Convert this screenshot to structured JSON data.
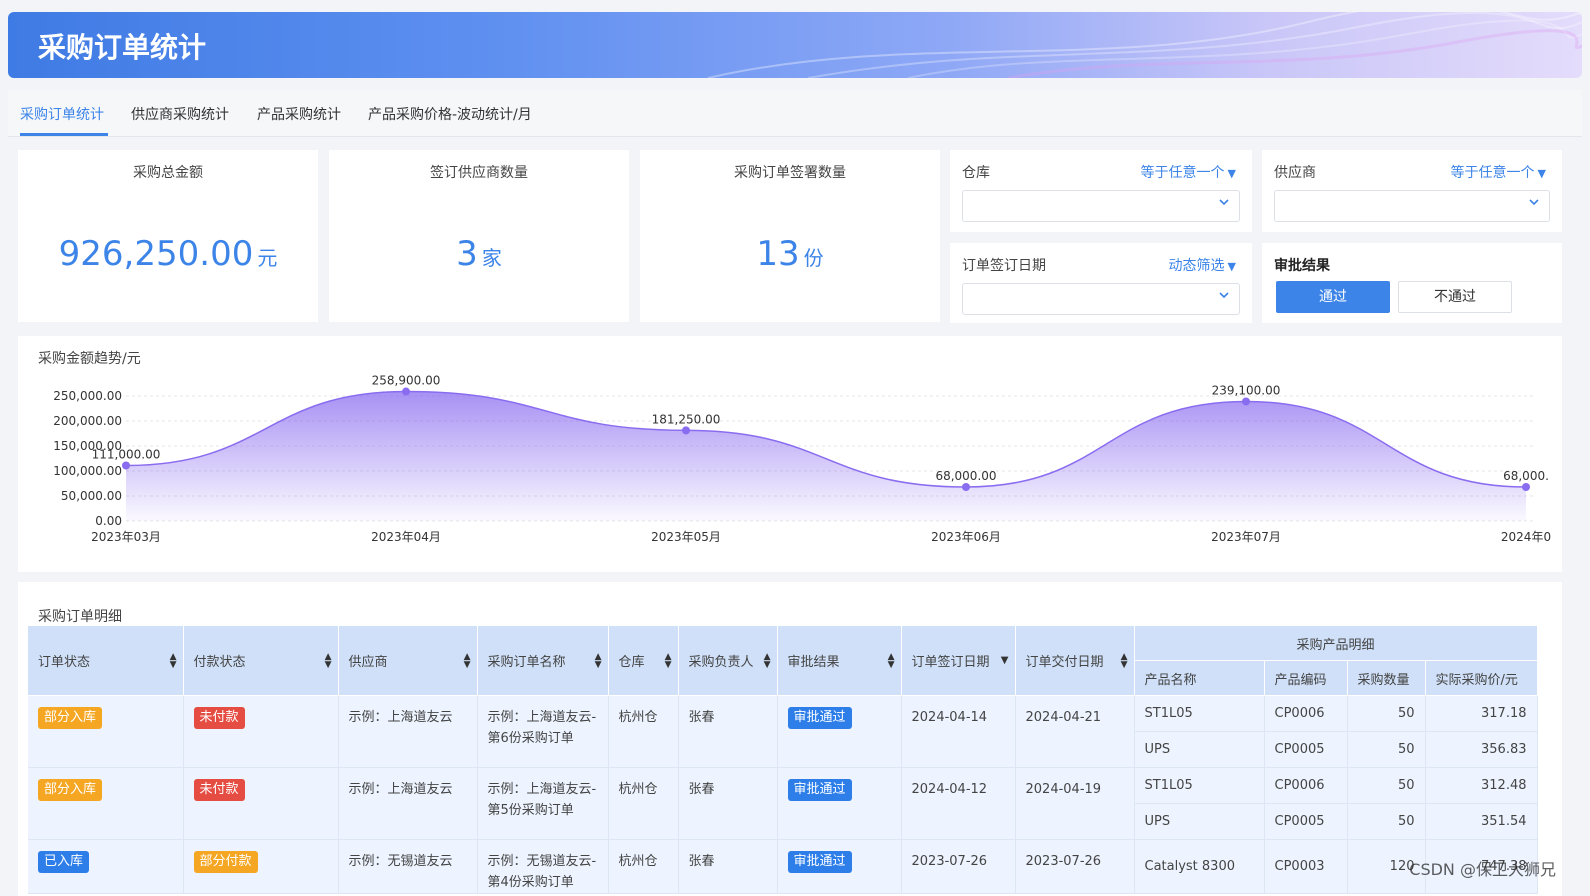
{
  "header": {
    "title": "采购订单统计"
  },
  "tabs": [
    "采购订单统计",
    "供应商采购统计",
    "产品采购统计",
    "产品采购价格-波动统计/月"
  ],
  "kpis": [
    {
      "label": "采购总金额",
      "value": "926,250.00",
      "unit": "元"
    },
    {
      "label": "签订供应商数量",
      "value": "3",
      "unit": "家"
    },
    {
      "label": "采购订单签署数量",
      "value": "13",
      "unit": "份"
    }
  ],
  "filters": {
    "warehouse": {
      "label": "仓库",
      "mode": "等于任意一个"
    },
    "supplier": {
      "label": "供应商",
      "mode": "等于任意一个"
    },
    "sign_date": {
      "label": "订单签订日期",
      "mode": "动态筛选"
    },
    "approval": {
      "label": "审批结果",
      "pass": "通过",
      "fail": "不通过"
    }
  },
  "chart_title": "采购金额趋势/元",
  "chart_data": {
    "type": "area",
    "categories": [
      "2023年03月",
      "2023年04月",
      "2023年05月",
      "2023年06月",
      "2023年07月",
      "2024年0"
    ],
    "values": [
      111000,
      258900,
      181250,
      68000,
      239100,
      68000
    ],
    "data_labels": [
      "111,000.00",
      "258,900.00",
      "181,250.00",
      "68,000.00",
      "239,100.00",
      "68,000."
    ],
    "yticks": [
      "250,000.00",
      "200,000.00",
      "150,000.00",
      "100,000.00",
      "50,000.00",
      "0.00"
    ],
    "ylim": [
      0,
      250000
    ],
    "color": "#8a6cf0"
  },
  "table": {
    "title": "采购订单明细",
    "headers": [
      "订单状态",
      "付款状态",
      "供应商",
      "采购订单名称",
      "仓库",
      "采购负责人",
      "审批结果",
      "订单签订日期",
      "订单交付日期"
    ],
    "group_header": "采购产品明细",
    "sub_headers": [
      "产品名称",
      "产品编码",
      "采购数量",
      "实际采购价/元"
    ],
    "orders": [
      {
        "order_status": "部分入库",
        "pay_status": "未付款",
        "supplier": "示例：上海道友云",
        "name": "示例：上海道友云-第6份采购订单",
        "warehouse": "杭州仓",
        "owner": "张春",
        "approval": "审批通过",
        "sign_date": "2024-04-14",
        "delivery_date": "2024-04-21",
        "items": [
          {
            "product": "ST1L05",
            "code": "CP0006",
            "qty": "50",
            "price": "317.18"
          },
          {
            "product": "UPS",
            "code": "CP0005",
            "qty": "50",
            "price": "356.83"
          }
        ]
      },
      {
        "order_status": "部分入库",
        "pay_status": "未付款",
        "supplier": "示例：上海道友云",
        "name": "示例：上海道友云-第5份采购订单",
        "warehouse": "杭州仓",
        "owner": "张春",
        "approval": "审批通过",
        "sign_date": "2024-04-12",
        "delivery_date": "2024-04-19",
        "items": [
          {
            "product": "ST1L05",
            "code": "CP0006",
            "qty": "50",
            "price": "312.48"
          },
          {
            "product": "UPS",
            "code": "CP0005",
            "qty": "50",
            "price": "351.54"
          }
        ]
      },
      {
        "order_status": "已入库",
        "pay_status": "部分付款",
        "supplier": "示例：无锡道友云",
        "name": "示例：无锡道友云-第4份采购订单",
        "warehouse": "杭州仓",
        "owner": "张春",
        "approval": "审批通过",
        "sign_date": "2023-07-26",
        "delivery_date": "2023-07-26",
        "items": [
          {
            "product": "Catalyst 8300",
            "code": "CP0003",
            "qty": "120",
            "price": "747.38"
          }
        ]
      }
    ]
  },
  "watermark": "CSDN @保卫大狮兄",
  "colors": {
    "accent": "#3c84e8",
    "orange": "#f5a623",
    "red": "#e54d42",
    "header_bg": "#cfe0f8",
    "row_bg": "#edf4ff"
  }
}
